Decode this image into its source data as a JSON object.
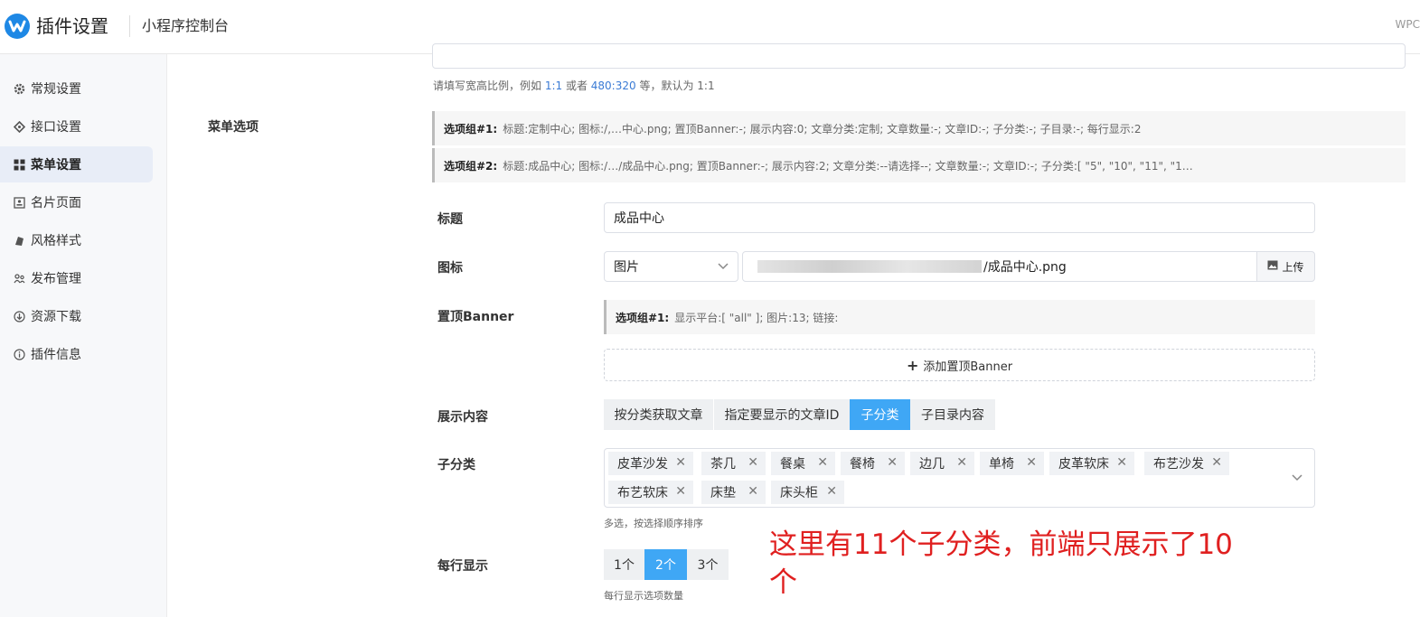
{
  "header": {
    "title": "插件设置",
    "subtitle": "小程序控制台",
    "right_text": "WPC"
  },
  "sidebar": {
    "items": [
      {
        "label": "常规设置",
        "icon": "gear-icon"
      },
      {
        "label": "接口设置",
        "icon": "api-icon"
      },
      {
        "label": "菜单设置",
        "icon": "grid-icon",
        "active": true
      },
      {
        "label": "名片页面",
        "icon": "card-icon"
      },
      {
        "label": "风格样式",
        "icon": "palette-icon"
      },
      {
        "label": "发布管理",
        "icon": "users-icon"
      },
      {
        "label": "资源下载",
        "icon": "download-icon"
      },
      {
        "label": "插件信息",
        "icon": "info-icon"
      }
    ]
  },
  "ratio": {
    "hint_prefix": "请填写宽高比例，例如 ",
    "hint_ex1": "1:1",
    "hint_mid": " 或者 ",
    "hint_ex2": "480:320",
    "hint_suffix": " 等，默认为 1:1"
  },
  "menu_options": {
    "label": "菜单选项",
    "groups": [
      {
        "name": "选项组#1:",
        "text": "标题:定制中心; 图标:/,…中心.png; 置顶Banner:-; 展示内容:0; 文章分类:定制; 文章数量:-; 文章ID:-; 子分类:-; 子目录:-; 每行显示:2"
      },
      {
        "name": "选项组#2:",
        "text": "标题:成品中心; 图标:/…/成品中心.png; 置顶Banner:-; 展示内容:2; 文章分类:--请选择--; 文章数量:-; 文章ID:-; 子分类:[ \"5\", \"10\", \"11\", \"1…"
      }
    ]
  },
  "form": {
    "title_label": "标题",
    "title_value": "成品中心",
    "icon_label": "图标",
    "icon_type": "图片",
    "icon_path": "/成品中心.png",
    "upload_label": "上传",
    "banner_label": "置顶Banner",
    "banner_group_name": "选项组#1:",
    "banner_group_text": "显示平台:[ \"all\" ]; 图片:13; 链接:",
    "add_banner_label": "添加置顶Banner",
    "display_label": "展示内容",
    "display_options": [
      "按分类获取文章",
      "指定要显示的文章ID",
      "子分类",
      "子目录内容"
    ],
    "display_selected": "子分类",
    "subcat_label": "子分类",
    "subcats": [
      "皮革沙发",
      "茶几",
      "餐桌",
      "餐椅",
      "边几",
      "单椅",
      "皮革软床",
      "布艺沙发",
      "布艺软床",
      "床垫",
      "床头柜"
    ],
    "subcat_hint": "多选，按选择顺序排序",
    "per_row_label": "每行显示",
    "per_row_options": [
      "1个",
      "2个",
      "3个"
    ],
    "per_row_selected": "2个",
    "per_row_hint": "每行显示选项数量"
  },
  "annotation": {
    "line1": "这里有11个子分类，前端只展示了10",
    "line2": "个"
  },
  "colors": {
    "accent": "#3fa7f5",
    "brand": "#1e88e5",
    "annotation": "#e02020"
  }
}
